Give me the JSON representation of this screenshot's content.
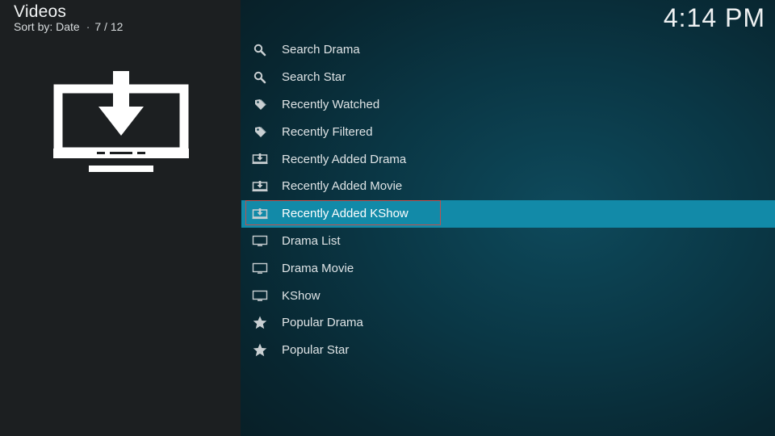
{
  "header": {
    "title": "Videos",
    "sort_label": "Sort by: Date",
    "separator": "·",
    "position": "7 / 12"
  },
  "clock": "4:14 PM",
  "thumbnail": {
    "icon": "download-to-monitor-icon"
  },
  "menu": {
    "selected_index": 6,
    "items": [
      {
        "label": "Search Drama",
        "icon": "search-icon"
      },
      {
        "label": "Search Star",
        "icon": "search-icon"
      },
      {
        "label": "Recently Watched",
        "icon": "tag-icon"
      },
      {
        "label": "Recently Filtered",
        "icon": "tag-icon"
      },
      {
        "label": "Recently Added Drama",
        "icon": "download-monitor-icon"
      },
      {
        "label": "Recently Added Movie",
        "icon": "download-monitor-icon"
      },
      {
        "label": "Recently Added KShow",
        "icon": "download-monitor-icon"
      },
      {
        "label": "Drama List",
        "icon": "monitor-icon"
      },
      {
        "label": "Drama Movie",
        "icon": "monitor-icon"
      },
      {
        "label": "KShow",
        "icon": "monitor-icon"
      },
      {
        "label": "Popular Drama",
        "icon": "star-icon"
      },
      {
        "label": "Popular Star",
        "icon": "star-icon"
      }
    ]
  },
  "colors": {
    "selected_bg": "#128aa8",
    "focus_border": "#c0504d",
    "left_panel": "#1c1f21"
  }
}
